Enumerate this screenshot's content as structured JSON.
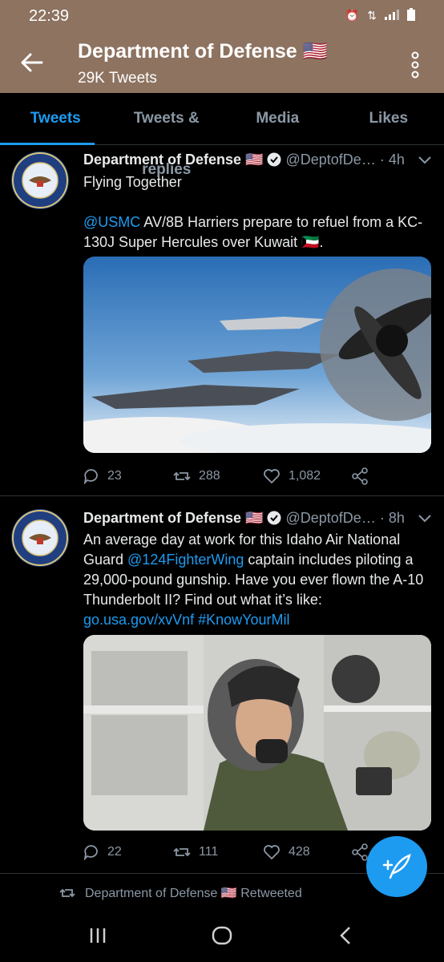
{
  "status": {
    "time": "22:39"
  },
  "header": {
    "title": "Department of Defense 🇺🇸",
    "subtitle": "29K Tweets"
  },
  "tabs": [
    {
      "label": "Tweets",
      "active": true
    },
    {
      "label": "Tweets & replies",
      "active": false
    },
    {
      "label": "Media",
      "active": false
    },
    {
      "label": "Likes",
      "active": false
    }
  ],
  "tweets": [
    {
      "name": "Department of Defense 🇺🇸",
      "handle": "@DeptofDe…",
      "time": "· 4h",
      "text_line1": "Flying Together",
      "mention": "@USMC",
      "text_rest": " AV/8B Harriers prepare to refuel from a KC-130J Super Hercules over Kuwait 🇰🇼.",
      "replies": "23",
      "retweets": "288",
      "likes": "1,082"
    },
    {
      "name": "Department of Defense 🇺🇸",
      "handle": "@DeptofDe…",
      "time": "· 8h",
      "text_a": "An average day at work for this Idaho Air National Guard ",
      "mention": "@124FighterWing",
      "text_b": " captain includes piloting a 29,000-pound gunship. Have you ever flown the A-10 Thunderbolt II? Find out what it’s like: ",
      "link": "go.usa.gov/xvVnf",
      "hashtag": "#KnowYourMil",
      "replies": "22",
      "retweets": "111",
      "likes": "428"
    }
  ],
  "retweet_note": "Department of Defense 🇺🇸 Retweeted",
  "colors": {
    "accent": "#1d9bf0",
    "header_bg": "#8d7360"
  }
}
